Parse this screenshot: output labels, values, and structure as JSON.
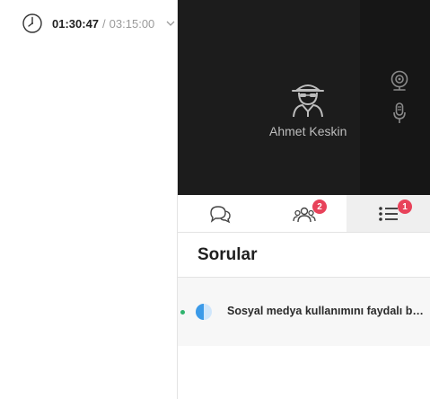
{
  "timer": {
    "elapsed": "01:30:47",
    "separator": "/",
    "total": "03:15:00",
    "icon": "clock-icon"
  },
  "video": {
    "user_name": "Ahmet Keskin",
    "avatar_icon": "anonymous-user-icon",
    "camera_icon": "webcam-icon",
    "mic_icon": "microphone-icon"
  },
  "tabs": [
    {
      "name": "chat",
      "icon": "chat-bubbles-icon",
      "badge": ""
    },
    {
      "name": "participants",
      "icon": "people-icon",
      "badge": "2"
    },
    {
      "name": "questions",
      "icon": "list-icon",
      "badge": "1",
      "active": true
    }
  ],
  "questions": {
    "title": "Sorular",
    "items": [
      {
        "text": "Sosyal medya kullanımını faydalı bu...",
        "progress": 0.5,
        "status_color": "#2fb36d",
        "progress_color": "#3b9ae8"
      }
    ]
  },
  "colors": {
    "video_bg": "#1c1c1c",
    "badge": "#e8425a",
    "active_tab_bg": "#efefef"
  }
}
